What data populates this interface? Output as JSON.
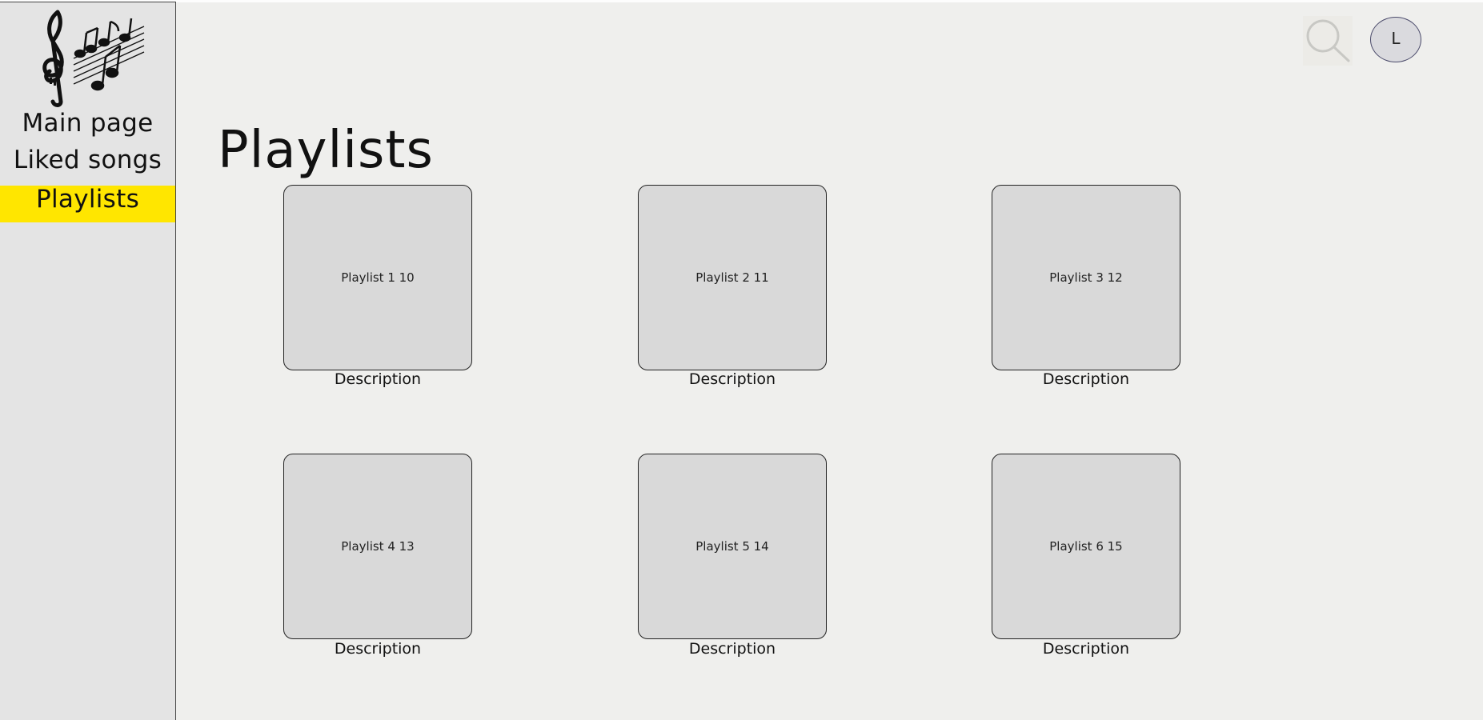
{
  "sidebar": {
    "nav": [
      {
        "label": "Main page"
      },
      {
        "label": "Liked songs"
      },
      {
        "label": "Playlists",
        "active": true
      }
    ]
  },
  "header": {
    "search_icon": "search-icon",
    "avatar_initial": "L"
  },
  "main": {
    "title": "Playlists",
    "playlists": [
      {
        "name": "Playlist 1 10",
        "description": "Description"
      },
      {
        "name": "Playlist 2 11",
        "description": "Description"
      },
      {
        "name": "Playlist 3 12",
        "description": "Description"
      },
      {
        "name": "Playlist 4 13",
        "description": "Description"
      },
      {
        "name": "Playlist 5 14",
        "description": "Description"
      },
      {
        "name": "Playlist 6 15",
        "description": "Description"
      }
    ]
  },
  "colors": {
    "active_nav": "#ffe600",
    "background": "#efefed",
    "sidebar": "#e4e4e4",
    "card": "#d9d9d9"
  }
}
